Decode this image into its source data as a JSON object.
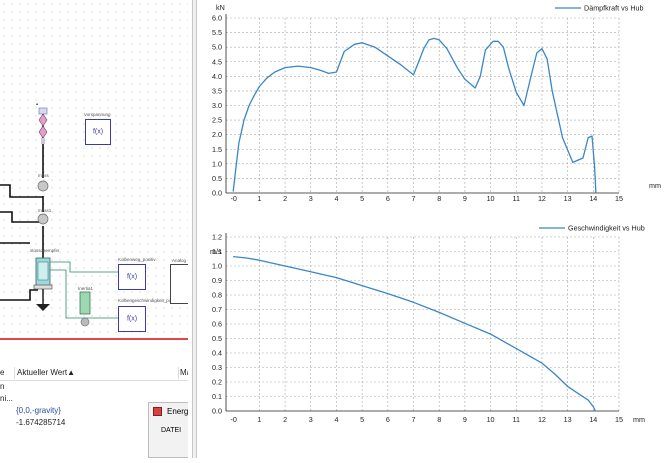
{
  "model_canvas": {
    "blocks": [
      {
        "label": "Vorspannung",
        "fx": "f(x)"
      },
      {
        "label": "Kolbenweg_positiv",
        "fx": "f(x)"
      },
      {
        "label": "Kolbengeschwindigkeit_positiv",
        "fx": "f(x)"
      },
      {
        "label": "Inertia1",
        "fx": ""
      },
      {
        "label": "stossdaempfer",
        "fx": ""
      },
      {
        "label": "mass1",
        "fx": ""
      },
      {
        "label": "Analog",
        "fx": ""
      }
    ]
  },
  "properties_panel": {
    "header_name": "e",
    "header_value": "Aktueller Wert▲",
    "header_extra": "Ma",
    "rows": [
      {
        "name": "n",
        "value": ""
      },
      {
        "name": "ni...",
        "value": ""
      },
      {
        "name": "",
        "value": "{0,0,-gravity}"
      },
      {
        "name": "",
        "value": "-1.674285714"
      }
    ]
  },
  "popup": {
    "label": "Energ",
    "sub": "DATEI"
  },
  "chart_data": [
    {
      "type": "line",
      "title": "",
      "xlabel": "mm",
      "ylabel": "kN",
      "xlim": [
        -0.3,
        15
      ],
      "ylim": [
        0,
        6
      ],
      "x_ticks": [
        "-0",
        "1",
        "2",
        "3",
        "4",
        "5",
        "6",
        "7",
        "8",
        "9",
        "10",
        "11",
        "12",
        "13",
        "14",
        "15"
      ],
      "y_ticks": [
        "0.0",
        "0.5",
        "1.0",
        "1.5",
        "2.0",
        "2.5",
        "3.0",
        "3.5",
        "4.0",
        "4.5",
        "5.0",
        "5.5",
        "6.0"
      ],
      "grid": true,
      "legend_position": "top-right",
      "series": [
        {
          "name": "Dämpfkraft vs Hub",
          "color": "#3a86c8",
          "x": [
            -0.02,
            0.05,
            0.2,
            0.4,
            0.6,
            0.8,
            1.0,
            1.3,
            1.6,
            2.0,
            2.5,
            3.0,
            3.4,
            3.7,
            4.0,
            4.3,
            4.7,
            5.0,
            5.5,
            6.0,
            6.5,
            7.0,
            7.4,
            7.6,
            7.8,
            8.0,
            8.3,
            8.7,
            9.0,
            9.4,
            9.6,
            9.8,
            10.1,
            10.3,
            10.5,
            10.7,
            11.0,
            11.3,
            11.6,
            11.8,
            12.0,
            12.2,
            12.4,
            12.8,
            13.2,
            13.6,
            13.8,
            13.95,
            14.05,
            14.1
          ],
          "y": [
            0.05,
            0.6,
            1.7,
            2.5,
            3.0,
            3.35,
            3.65,
            3.95,
            4.15,
            4.3,
            4.35,
            4.3,
            4.2,
            4.1,
            4.15,
            4.85,
            5.1,
            5.15,
            5.0,
            4.7,
            4.4,
            4.05,
            4.95,
            5.25,
            5.3,
            5.25,
            4.95,
            4.3,
            3.9,
            3.6,
            4.0,
            4.9,
            5.2,
            5.2,
            5.0,
            4.3,
            3.45,
            3.0,
            4.1,
            4.8,
            4.95,
            4.6,
            3.5,
            1.9,
            1.05,
            1.2,
            1.9,
            1.95,
            0.9,
            0.0
          ]
        }
      ]
    },
    {
      "type": "line",
      "title": "",
      "xlabel": "mm",
      "ylabel": "m/s",
      "xlim": [
        -0.3,
        15
      ],
      "ylim": [
        0,
        1.2
      ],
      "x_ticks": [
        "-0",
        "1",
        "2",
        "3",
        "4",
        "5",
        "6",
        "7",
        "8",
        "9",
        "10",
        "11",
        "12",
        "13",
        "14",
        "15"
      ],
      "y_ticks": [
        "0.0",
        "0.1",
        "0.2",
        "0.3",
        "0.4",
        "0.5",
        "0.6",
        "0.7",
        "0.8",
        "0.9",
        "1.0",
        "1.1",
        "1.2"
      ],
      "grid": true,
      "legend_position": "top-right",
      "series": [
        {
          "name": "Geschwindigkeit vs Hub",
          "color": "#3a86c8",
          "x": [
            -0.02,
            0.5,
            1.0,
            1.5,
            2.0,
            3.0,
            4.0,
            5.0,
            6.0,
            7.0,
            8.0,
            9.0,
            10.0,
            11.0,
            12.0,
            12.5,
            13.0,
            13.5,
            13.8,
            14.0,
            14.08
          ],
          "y": [
            1.065,
            1.055,
            1.04,
            1.02,
            1.0,
            0.96,
            0.92,
            0.865,
            0.81,
            0.75,
            0.68,
            0.605,
            0.53,
            0.43,
            0.33,
            0.255,
            0.17,
            0.11,
            0.075,
            0.03,
            0.0
          ]
        }
      ]
    }
  ]
}
